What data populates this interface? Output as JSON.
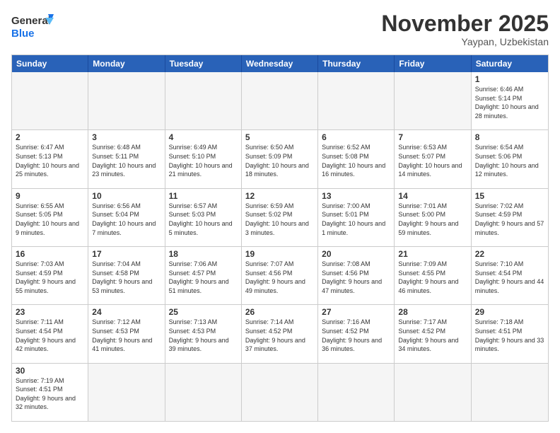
{
  "header": {
    "logo_general": "General",
    "logo_blue": "Blue",
    "month_title": "November 2025",
    "location": "Yaypan, Uzbekistan"
  },
  "days": {
    "headers": [
      "Sunday",
      "Monday",
      "Tuesday",
      "Wednesday",
      "Thursday",
      "Friday",
      "Saturday"
    ]
  },
  "weeks": [
    [
      {
        "num": "",
        "info": "",
        "empty": true
      },
      {
        "num": "",
        "info": "",
        "empty": true
      },
      {
        "num": "",
        "info": "",
        "empty": true
      },
      {
        "num": "",
        "info": "",
        "empty": true
      },
      {
        "num": "",
        "info": "",
        "empty": true
      },
      {
        "num": "",
        "info": "",
        "empty": true
      },
      {
        "num": "1",
        "info": "Sunrise: 6:46 AM\nSunset: 5:14 PM\nDaylight: 10 hours and 28 minutes.",
        "empty": false
      }
    ],
    [
      {
        "num": "2",
        "info": "Sunrise: 6:47 AM\nSunset: 5:13 PM\nDaylight: 10 hours and 25 minutes.",
        "empty": false
      },
      {
        "num": "3",
        "info": "Sunrise: 6:48 AM\nSunset: 5:11 PM\nDaylight: 10 hours and 23 minutes.",
        "empty": false
      },
      {
        "num": "4",
        "info": "Sunrise: 6:49 AM\nSunset: 5:10 PM\nDaylight: 10 hours and 21 minutes.",
        "empty": false
      },
      {
        "num": "5",
        "info": "Sunrise: 6:50 AM\nSunset: 5:09 PM\nDaylight: 10 hours and 18 minutes.",
        "empty": false
      },
      {
        "num": "6",
        "info": "Sunrise: 6:52 AM\nSunset: 5:08 PM\nDaylight: 10 hours and 16 minutes.",
        "empty": false
      },
      {
        "num": "7",
        "info": "Sunrise: 6:53 AM\nSunset: 5:07 PM\nDaylight: 10 hours and 14 minutes.",
        "empty": false
      },
      {
        "num": "8",
        "info": "Sunrise: 6:54 AM\nSunset: 5:06 PM\nDaylight: 10 hours and 12 minutes.",
        "empty": false
      }
    ],
    [
      {
        "num": "9",
        "info": "Sunrise: 6:55 AM\nSunset: 5:05 PM\nDaylight: 10 hours and 9 minutes.",
        "empty": false
      },
      {
        "num": "10",
        "info": "Sunrise: 6:56 AM\nSunset: 5:04 PM\nDaylight: 10 hours and 7 minutes.",
        "empty": false
      },
      {
        "num": "11",
        "info": "Sunrise: 6:57 AM\nSunset: 5:03 PM\nDaylight: 10 hours and 5 minutes.",
        "empty": false
      },
      {
        "num": "12",
        "info": "Sunrise: 6:59 AM\nSunset: 5:02 PM\nDaylight: 10 hours and 3 minutes.",
        "empty": false
      },
      {
        "num": "13",
        "info": "Sunrise: 7:00 AM\nSunset: 5:01 PM\nDaylight: 10 hours and 1 minute.",
        "empty": false
      },
      {
        "num": "14",
        "info": "Sunrise: 7:01 AM\nSunset: 5:00 PM\nDaylight: 9 hours and 59 minutes.",
        "empty": false
      },
      {
        "num": "15",
        "info": "Sunrise: 7:02 AM\nSunset: 4:59 PM\nDaylight: 9 hours and 57 minutes.",
        "empty": false
      }
    ],
    [
      {
        "num": "16",
        "info": "Sunrise: 7:03 AM\nSunset: 4:59 PM\nDaylight: 9 hours and 55 minutes.",
        "empty": false
      },
      {
        "num": "17",
        "info": "Sunrise: 7:04 AM\nSunset: 4:58 PM\nDaylight: 9 hours and 53 minutes.",
        "empty": false
      },
      {
        "num": "18",
        "info": "Sunrise: 7:06 AM\nSunset: 4:57 PM\nDaylight: 9 hours and 51 minutes.",
        "empty": false
      },
      {
        "num": "19",
        "info": "Sunrise: 7:07 AM\nSunset: 4:56 PM\nDaylight: 9 hours and 49 minutes.",
        "empty": false
      },
      {
        "num": "20",
        "info": "Sunrise: 7:08 AM\nSunset: 4:56 PM\nDaylight: 9 hours and 47 minutes.",
        "empty": false
      },
      {
        "num": "21",
        "info": "Sunrise: 7:09 AM\nSunset: 4:55 PM\nDaylight: 9 hours and 46 minutes.",
        "empty": false
      },
      {
        "num": "22",
        "info": "Sunrise: 7:10 AM\nSunset: 4:54 PM\nDaylight: 9 hours and 44 minutes.",
        "empty": false
      }
    ],
    [
      {
        "num": "23",
        "info": "Sunrise: 7:11 AM\nSunset: 4:54 PM\nDaylight: 9 hours and 42 minutes.",
        "empty": false
      },
      {
        "num": "24",
        "info": "Sunrise: 7:12 AM\nSunset: 4:53 PM\nDaylight: 9 hours and 41 minutes.",
        "empty": false
      },
      {
        "num": "25",
        "info": "Sunrise: 7:13 AM\nSunset: 4:53 PM\nDaylight: 9 hours and 39 minutes.",
        "empty": false
      },
      {
        "num": "26",
        "info": "Sunrise: 7:14 AM\nSunset: 4:52 PM\nDaylight: 9 hours and 37 minutes.",
        "empty": false
      },
      {
        "num": "27",
        "info": "Sunrise: 7:16 AM\nSunset: 4:52 PM\nDaylight: 9 hours and 36 minutes.",
        "empty": false
      },
      {
        "num": "28",
        "info": "Sunrise: 7:17 AM\nSunset: 4:52 PM\nDaylight: 9 hours and 34 minutes.",
        "empty": false
      },
      {
        "num": "29",
        "info": "Sunrise: 7:18 AM\nSunset: 4:51 PM\nDaylight: 9 hours and 33 minutes.",
        "empty": false
      }
    ],
    [
      {
        "num": "30",
        "info": "Sunrise: 7:19 AM\nSunset: 4:51 PM\nDaylight: 9 hours and 32 minutes.",
        "empty": false
      },
      {
        "num": "",
        "info": "",
        "empty": true
      },
      {
        "num": "",
        "info": "",
        "empty": true
      },
      {
        "num": "",
        "info": "",
        "empty": true
      },
      {
        "num": "",
        "info": "",
        "empty": true
      },
      {
        "num": "",
        "info": "",
        "empty": true
      },
      {
        "num": "",
        "info": "",
        "empty": true
      }
    ]
  ]
}
